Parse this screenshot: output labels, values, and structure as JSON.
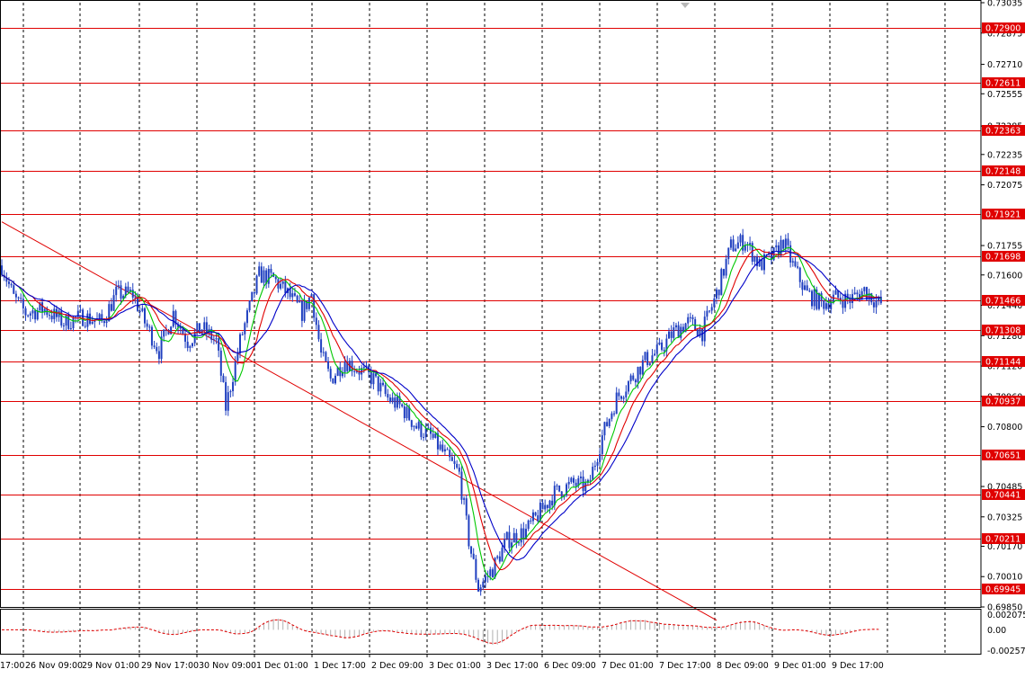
{
  "chart_data": {
    "type": "candlestick",
    "instrument_note": "",
    "price_axis": {
      "ylim": [
        0.6985,
        0.73035
      ],
      "tick_labels": [
        "0.73035",
        "0.72875",
        "0.72710",
        "0.72555",
        "0.72385",
        "0.72235",
        "0.72075",
        "0.71755",
        "0.71600",
        "0.71440",
        "0.71280",
        "0.71120",
        "0.70960",
        "0.70800",
        "0.70485",
        "0.70325",
        "0.70170",
        "0.70010",
        "0.69850"
      ]
    },
    "time_axis": {
      "labels": [
        "26 Nov 09:00",
        "29 Nov 01:00",
        "29 Nov 17:00",
        "30 Nov 09:00",
        "1 Dec 01:00",
        "1 Dec 17:00",
        "2 Dec 09:00",
        "3 Dec 01:00",
        "3 Dec 17:00",
        "6 Dec 09:00",
        "7 Dec 01:00",
        "7 Dec 17:00",
        "8 Dec 09:00",
        "9 Dec 01:00",
        "9 Dec 17:00"
      ],
      "partial_first_label": "17:00"
    },
    "horizontal_levels": [
      0.729,
      0.72611,
      0.72363,
      0.72148,
      0.71921,
      0.71698,
      0.71466,
      0.71308,
      0.71144,
      0.70937,
      0.70651,
      0.70441,
      0.70211,
      0.69945
    ],
    "level_labels": [
      "0.72900",
      "0.72611",
      "0.72363",
      "0.72148",
      "0.71921",
      "0.71698",
      "0.71466",
      "0.71308",
      "0.71144",
      "0.70937",
      "0.70651",
      "0.70441",
      "0.70211",
      "0.69945"
    ],
    "trend_line": {
      "from": {
        "bar": 0,
        "price": 0.7188
      },
      "to": {
        "bar": 300,
        "price": 0.6978
      }
    },
    "price_path_keypoints": [
      [
        0,
        0.7165
      ],
      [
        5,
        0.7148
      ],
      [
        10,
        0.714
      ],
      [
        18,
        0.7142
      ],
      [
        26,
        0.7135
      ],
      [
        34,
        0.7138
      ],
      [
        42,
        0.7135
      ],
      [
        48,
        0.715
      ],
      [
        55,
        0.715
      ],
      [
        60,
        0.7135
      ],
      [
        66,
        0.712
      ],
      [
        72,
        0.714
      ],
      [
        78,
        0.7125
      ],
      [
        84,
        0.7132
      ],
      [
        90,
        0.7125
      ],
      [
        94,
        0.709
      ],
      [
        100,
        0.7125
      ],
      [
        108,
        0.716
      ],
      [
        114,
        0.7158
      ],
      [
        120,
        0.715
      ],
      [
        126,
        0.714
      ],
      [
        130,
        0.715
      ],
      [
        134,
        0.7118
      ],
      [
        138,
        0.7105
      ],
      [
        144,
        0.7115
      ],
      [
        150,
        0.711
      ],
      [
        156,
        0.7105
      ],
      [
        162,
        0.7095
      ],
      [
        168,
        0.709
      ],
      [
        174,
        0.708
      ],
      [
        180,
        0.7075
      ],
      [
        186,
        0.7065
      ],
      [
        192,
        0.7055
      ],
      [
        196,
        0.702
      ],
      [
        200,
        0.6995
      ],
      [
        206,
        0.7005
      ],
      [
        212,
        0.702
      ],
      [
        220,
        0.7025
      ],
      [
        226,
        0.7035
      ],
      [
        232,
        0.7045
      ],
      [
        240,
        0.705
      ],
      [
        246,
        0.7048
      ],
      [
        252,
        0.7075
      ],
      [
        258,
        0.7095
      ],
      [
        264,
        0.7105
      ],
      [
        270,
        0.7115
      ],
      [
        276,
        0.712
      ],
      [
        282,
        0.713
      ],
      [
        288,
        0.7135
      ],
      [
        294,
        0.713
      ],
      [
        300,
        0.715
      ],
      [
        306,
        0.7175
      ],
      [
        312,
        0.7178
      ],
      [
        318,
        0.7165
      ],
      [
        324,
        0.717
      ],
      [
        328,
        0.7178
      ],
      [
        332,
        0.7165
      ],
      [
        338,
        0.715
      ],
      [
        344,
        0.7145
      ],
      [
        350,
        0.7148
      ],
      [
        356,
        0.7147
      ],
      [
        362,
        0.7152
      ],
      [
        368,
        0.7145
      ]
    ],
    "moving_averages": [
      {
        "color": "#00c800",
        "period": 8
      },
      {
        "color": "#e00000",
        "period": 14
      },
      {
        "color": "#0000c8",
        "period": 21
      }
    ],
    "oscillator": {
      "ylim": [
        -0.00257,
        0.00207
      ],
      "tick_labels": [
        "0.002075",
        "0.00",
        "-0.002571"
      ]
    }
  }
}
